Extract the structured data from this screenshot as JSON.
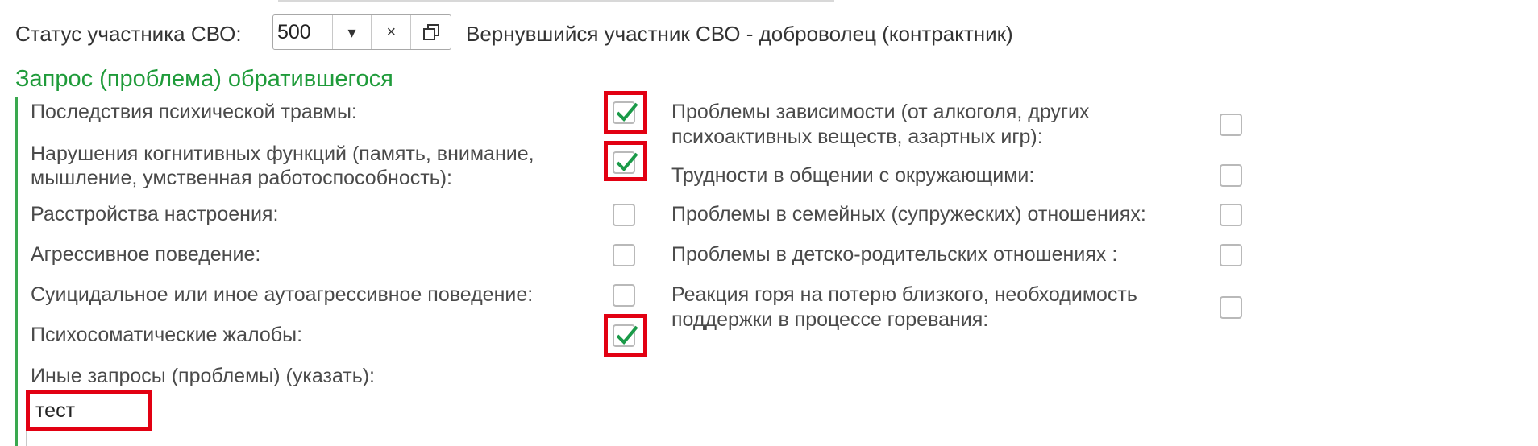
{
  "status": {
    "label": "Статус участника СВО:",
    "value": "500",
    "dropdown_glyph": "▾",
    "clear_glyph": "×",
    "description": "Вернувшийся участник СВО - доброволец (контрактник)"
  },
  "section": {
    "title": "Запрос (проблема) обратившегося"
  },
  "left_items": [
    {
      "line1": "Последствия психической травмы:",
      "line2": "",
      "checked": true
    },
    {
      "line1": "Нарушения когнитивных функций (память, внимание,",
      "line2": "мышление, умственная работоспособность):",
      "checked": true
    },
    {
      "line1": "Расстройства настроения:",
      "line2": "",
      "checked": false
    },
    {
      "line1": "Агрессивное поведение:",
      "line2": "",
      "checked": false
    },
    {
      "line1": "Суицидальное или иное аутоагрессивное поведение:",
      "line2": "",
      "checked": false
    },
    {
      "line1": "Психосоматические жалобы:",
      "line2": "",
      "checked": true
    }
  ],
  "right_items": [
    {
      "line1": "Проблемы зависимости (от алкоголя, других",
      "line2": "психоактивных веществ, азартных игр):",
      "checked": false
    },
    {
      "line1": "Трудности в общении с окружающими:",
      "line2": "",
      "checked": false
    },
    {
      "line1": "Проблемы в семейных (супружеских) отношениях:",
      "line2": "",
      "checked": false
    },
    {
      "line1": "Проблемы в детско-родительских отношениях :",
      "line2": "",
      "checked": false
    },
    {
      "line1": "Реакция горя на потерю близкого, необходимость",
      "line2": "поддержки в процессе горевания:",
      "checked": false
    }
  ],
  "other": {
    "label": "Иные запросы (проблемы) (указать):",
    "value": "тест"
  },
  "colors": {
    "accent_green": "#1f9b3a",
    "check_green": "#1a9a48",
    "highlight_red": "#e20012"
  }
}
